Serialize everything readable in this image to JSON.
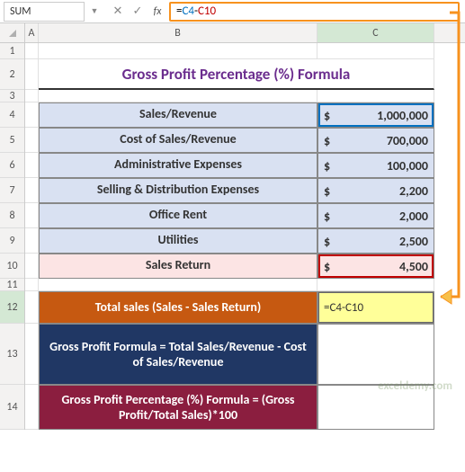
{
  "name_box": "SUM",
  "formula": {
    "prefix": "=",
    "ref1": "C4",
    "op": "-",
    "ref2": "C10"
  },
  "columns": [
    "A",
    "B",
    "C"
  ],
  "row_numbers": [
    "1",
    "2",
    "3",
    "4",
    "5",
    "6",
    "7",
    "8",
    "9",
    "10",
    "11",
    "12",
    "13",
    "14"
  ],
  "title": "Gross Profit Percentage (%) Formula",
  "data_rows": [
    {
      "label": "Sales/Revenue",
      "sym": "$",
      "value": "1,000,000"
    },
    {
      "label": "Cost of Sales/Revenue",
      "sym": "$",
      "value": "700,000"
    },
    {
      "label": "Administrative Expenses",
      "sym": "$",
      "value": "100,000"
    },
    {
      "label": "Selling & Distribution Expenses",
      "sym": "$",
      "value": "2,200"
    },
    {
      "label": "Office Rent",
      "sym": "$",
      "value": "2,000"
    },
    {
      "label": "Utilities",
      "sym": "$",
      "value": "2,500"
    },
    {
      "label": "Sales Return",
      "sym": "$",
      "value": "4,500"
    }
  ],
  "formula_rows": {
    "r1": {
      "label": "Total sales (Sales - Sales Return)",
      "value": "=C4-C10"
    },
    "r2": {
      "label": "Gross Profit Formula = Total Sales/Revenue\n- Cost of Sales/Revenue",
      "value": ""
    },
    "r3": {
      "label": "Gross Profit Percentage (%) Formula\n= (Gross Profit/Total Sales)*100",
      "value": ""
    }
  },
  "watermark": "exceldemy.com",
  "chart_data": {
    "type": "table",
    "title": "Gross Profit Percentage (%) Formula",
    "rows": [
      [
        "Sales/Revenue",
        1000000
      ],
      [
        "Cost of Sales/Revenue",
        700000
      ],
      [
        "Administrative Expenses",
        100000
      ],
      [
        "Selling & Distribution Expenses",
        2200
      ],
      [
        "Office Rent",
        2000
      ],
      [
        "Utilities",
        2500
      ],
      [
        "Sales Return",
        4500
      ]
    ],
    "formulas": [
      [
        "Total sales (Sales - Sales Return)",
        "=C4-C10"
      ],
      [
        "Gross Profit Formula = Total Sales/Revenue - Cost of Sales/Revenue",
        ""
      ],
      [
        "Gross Profit Percentage (%) Formula = (Gross Profit/Total Sales)*100",
        ""
      ]
    ]
  }
}
